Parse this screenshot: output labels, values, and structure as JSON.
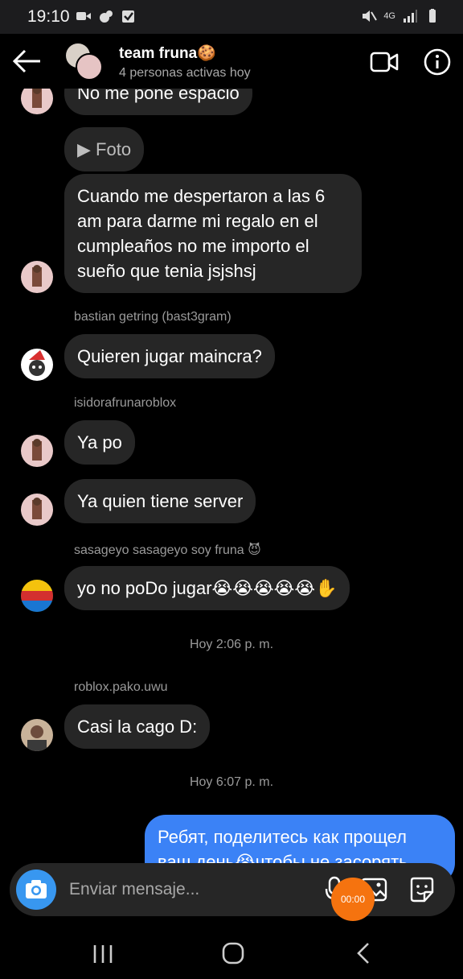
{
  "status_bar": {
    "time": "19:10",
    "network": "4G"
  },
  "header": {
    "title": "team fruna🍪",
    "subtitle": "4 personas activas hoy",
    "back_icon": "arrow-left-icon",
    "video_icon": "video-camera-icon",
    "info_icon": "info-icon"
  },
  "messages": [
    {
      "text": "No me pone espacio"
    },
    {
      "text": "▶ Foto"
    },
    {
      "text": "Cuando me despertaron a las 6 am para darme mi regalo en el cumpleaños no me importo el sueño que tenia jsjshsj"
    },
    {
      "sender": "bastian getring (bast3gram)",
      "text": "Quieren jugar maincra?"
    },
    {
      "sender": "isidorafrunaroblox",
      "text": "Ya po"
    },
    {
      "text": "Ya quien tiene server"
    },
    {
      "sender": "sasageyo sasageyo soy fruna 😈",
      "text": "yo no poDo jugar😭😭😭😭😭✋"
    },
    {
      "timestamp": "Hoy 2:06 p. m."
    },
    {
      "sender": "roblox.pako.uwu",
      "text": "Casi la cago D:"
    },
    {
      "timestamp": "Hoy 6:07 p. m."
    },
    {
      "text": "Ребят, поделитесь как прощел ваш день😭чтобы не засорять"
    }
  ],
  "composer": {
    "placeholder": "Enviar mensaje...",
    "recording_time": "00:00"
  },
  "colors": {
    "accent": "#3897f0",
    "outgoing_bubble": "#3b82f6",
    "incoming_bubble": "#262626",
    "record": "#f5730f"
  }
}
